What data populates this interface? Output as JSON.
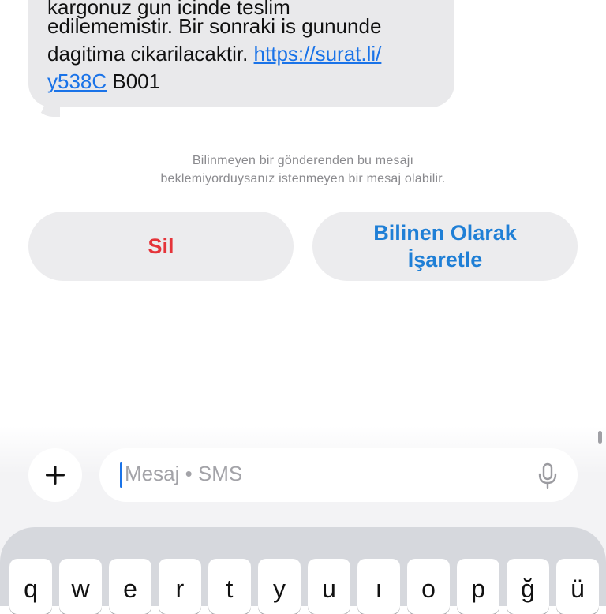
{
  "message": {
    "lines": [
      "kargonuz gun icinde teslim",
      "edilememistir. Bir sonraki is gununde",
      "dagitima cikarilacaktir. "
    ],
    "link_part1": "https://surat.li/",
    "link_part2": "y538C",
    "suffix": " B001"
  },
  "notice": {
    "line1": "Bilinmeyen bir gönderenden bu mesajı",
    "line2": "beklemiyorduysanız istenmeyen bir mesaj olabilir."
  },
  "actions": {
    "delete_label": "Sil",
    "mark_known_line1": "Bilinen Olarak",
    "mark_known_line2": "İşaretle"
  },
  "composer": {
    "plus": "+",
    "placeholder": "Mesaj • SMS"
  },
  "keyboard": {
    "row1": [
      "q",
      "w",
      "e",
      "r",
      "t",
      "y",
      "u",
      "ı",
      "o",
      "p",
      "ğ",
      "ü"
    ]
  },
  "colors": {
    "delete": "#e5343a",
    "link": "#1a73e8",
    "known": "#1f7fd6"
  }
}
